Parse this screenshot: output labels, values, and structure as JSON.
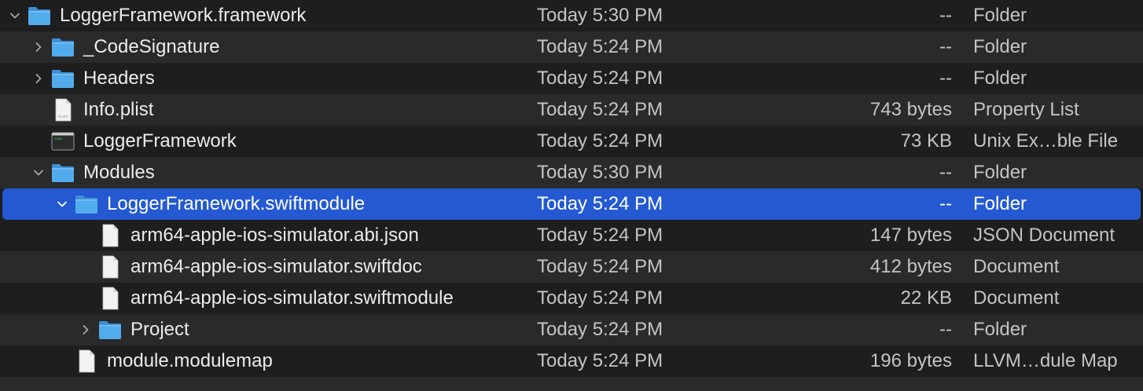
{
  "colors": {
    "background": "#1e1e1e",
    "alternate_row": "#2a2a2a",
    "selection": "#2459d1",
    "folder_blue": "#52acec"
  },
  "rows": [
    {
      "name": "LoggerFramework.framework",
      "date": "Today 5:30 PM",
      "size": "--",
      "kind": "Folder",
      "icon": "folder-icon",
      "disclosure": "expanded"
    },
    {
      "name": "_CodeSignature",
      "date": "Today 5:24 PM",
      "size": "--",
      "kind": "Folder",
      "icon": "folder-icon",
      "disclosure": "collapsed"
    },
    {
      "name": "Headers",
      "date": "Today 5:24 PM",
      "size": "--",
      "kind": "Folder",
      "icon": "folder-icon",
      "disclosure": "collapsed"
    },
    {
      "name": "Info.plist",
      "date": "Today 5:24 PM",
      "size": "743 bytes",
      "kind": "Property List",
      "icon": "plist-file-icon",
      "icon_label": "PLIST",
      "disclosure": "none"
    },
    {
      "name": "LoggerFramework",
      "date": "Today 5:24 PM",
      "size": "73 KB",
      "kind": "Unix Ex…ble File",
      "icon": "unix-executable-icon",
      "icon_label": "exec",
      "disclosure": "none"
    },
    {
      "name": "Modules",
      "date": "Today 5:30 PM",
      "size": "--",
      "kind": "Folder",
      "icon": "folder-icon",
      "disclosure": "expanded"
    },
    {
      "name": "LoggerFramework.swiftmodule",
      "date": "Today 5:24 PM",
      "size": "--",
      "kind": "Folder",
      "icon": "folder-icon",
      "disclosure": "expanded",
      "selected": true
    },
    {
      "name": "arm64-apple-ios-simulator.abi.json",
      "date": "Today 5:24 PM",
      "size": "147 bytes",
      "kind": "JSON Document",
      "icon": "document-icon",
      "disclosure": "none"
    },
    {
      "name": "arm64-apple-ios-simulator.swiftdoc",
      "date": "Today 5:24 PM",
      "size": "412 bytes",
      "kind": "Document",
      "icon": "document-icon",
      "disclosure": "none"
    },
    {
      "name": "arm64-apple-ios-simulator.swiftmodule",
      "date": "Today 5:24 PM",
      "size": "22 KB",
      "kind": "Document",
      "icon": "document-icon",
      "disclosure": "none"
    },
    {
      "name": "Project",
      "date": "Today 5:24 PM",
      "size": "--",
      "kind": "Folder",
      "icon": "folder-icon",
      "disclosure": "collapsed"
    },
    {
      "name": "module.modulemap",
      "date": "Today 5:24 PM",
      "size": "196 bytes",
      "kind": "LLVM…dule Map",
      "icon": "document-icon",
      "disclosure": "none"
    }
  ]
}
